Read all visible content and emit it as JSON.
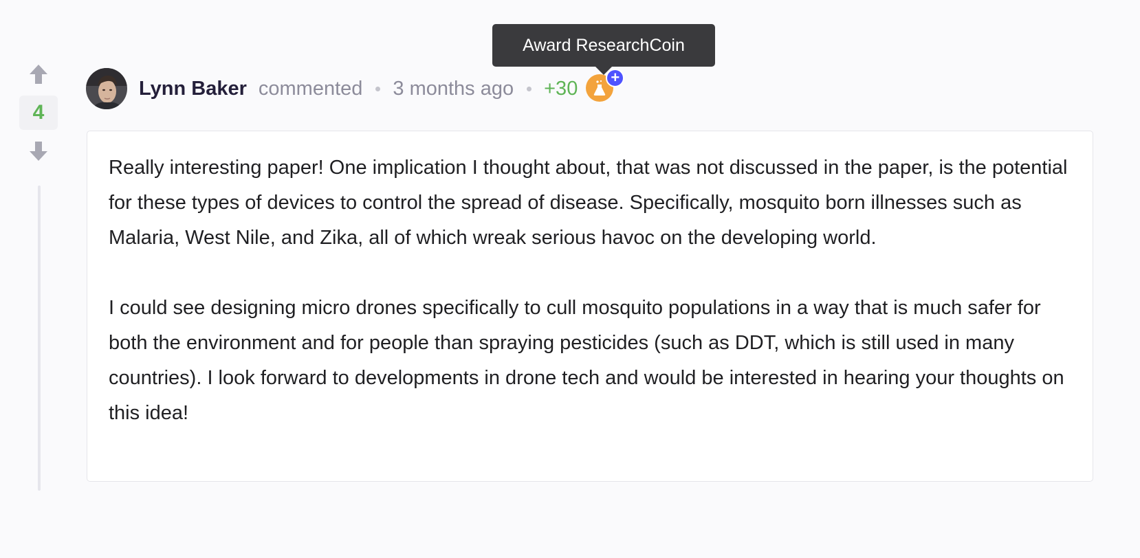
{
  "vote": {
    "count": "4"
  },
  "comment": {
    "author": "Lynn Baker",
    "action": "commented",
    "time": "3 months ago",
    "reward": "+30",
    "body": [
      "Really interesting paper! One implication I thought about, that was not discussed in the paper, is the potential for these types of devices to control the spread of disease. Specifically, mosquito born illnesses such as Malaria, West Nile, and Zika, all of which wreak serious havoc on the developing world.",
      "I could see designing micro drones specifically to cull mosquito populations in a way that is much safer for both the environment and for people than spraying pesticides (such as DDT, which is still used in many countries). I look forward to developments in drone tech and would be interested in hearing your thoughts on this idea!"
    ]
  },
  "tooltip": {
    "label": "Award ResearchCoin"
  },
  "icons": {
    "upvote": "arrow-up-icon",
    "downvote": "arrow-down-icon",
    "coin": "flask-coin-icon",
    "plus": "plus-icon"
  },
  "colors": {
    "vote_count": "#5fb456",
    "reward": "#5fb456",
    "coin": "#f3a33c",
    "plus_badge": "#4e53ff",
    "tooltip_bg": "#3a3a3d"
  }
}
